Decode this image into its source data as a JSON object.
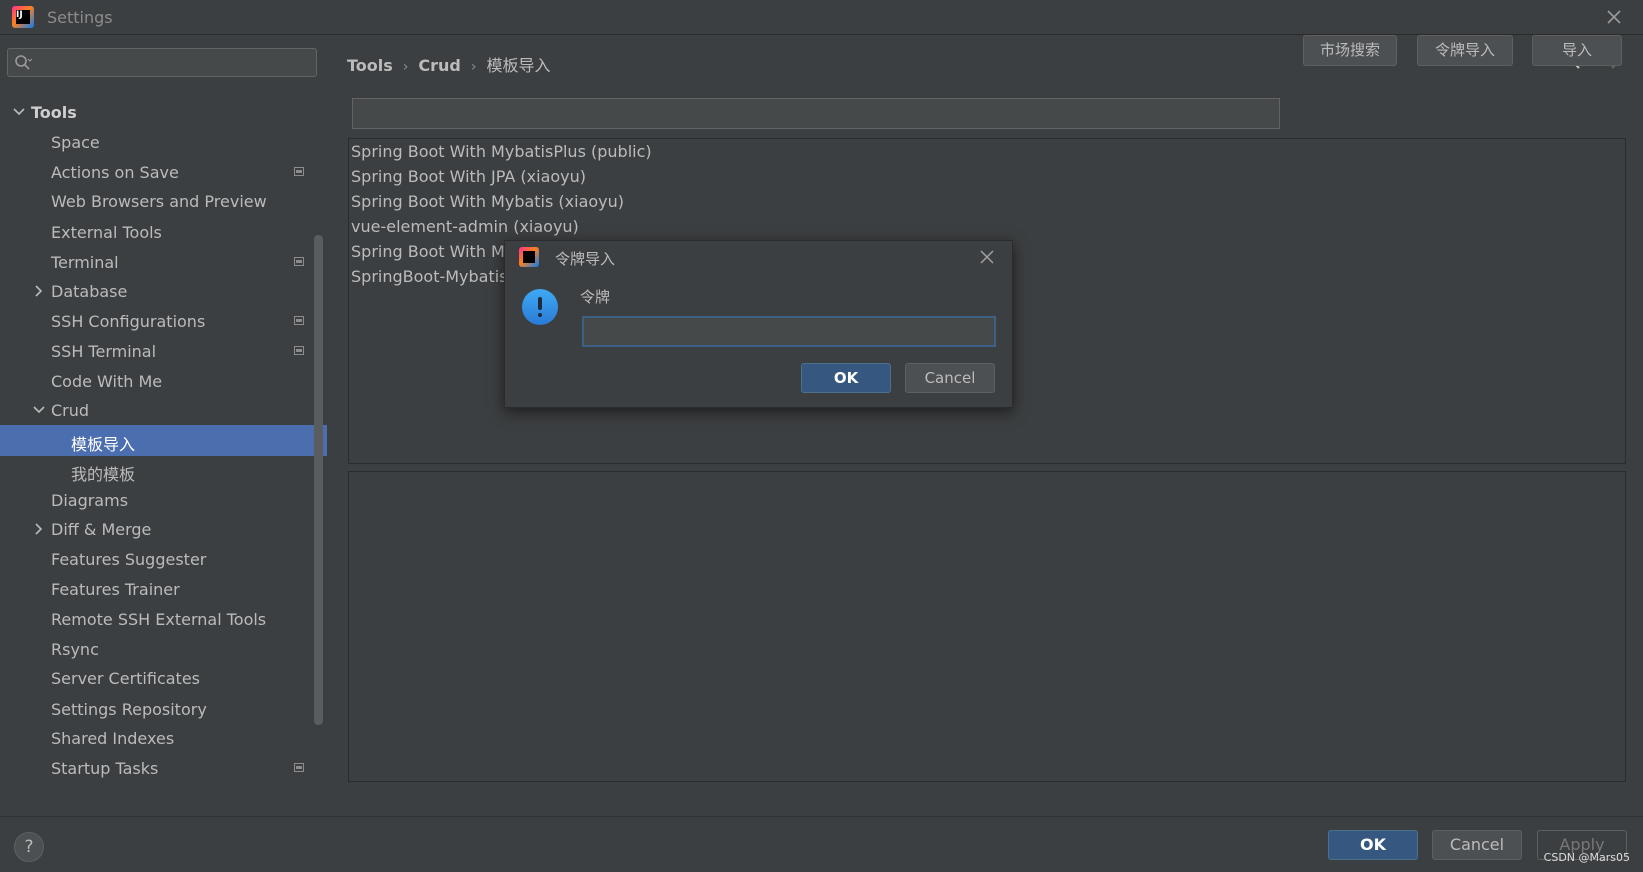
{
  "window": {
    "title": "Settings"
  },
  "sidebar": {
    "search": {
      "value": "",
      "placeholder": ""
    },
    "items": [
      {
        "label": "Tools",
        "expanded": true
      },
      {
        "label": "Space"
      },
      {
        "label": "Actions on Save"
      },
      {
        "label": "Web Browsers and Preview"
      },
      {
        "label": "External Tools"
      },
      {
        "label": "Terminal"
      },
      {
        "label": "Database",
        "expanded": false
      },
      {
        "label": "SSH Configurations"
      },
      {
        "label": "SSH Terminal"
      },
      {
        "label": "Code With Me"
      },
      {
        "label": "Crud",
        "expanded": true
      },
      {
        "label": "模板导入",
        "selected": true
      },
      {
        "label": "我的模板"
      },
      {
        "label": "Diagrams"
      },
      {
        "label": "Diff & Merge",
        "expanded": false
      },
      {
        "label": "Features Suggester"
      },
      {
        "label": "Features Trainer"
      },
      {
        "label": "Remote SSH External Tools"
      },
      {
        "label": "Rsync"
      },
      {
        "label": "Server Certificates"
      },
      {
        "label": "Settings Repository"
      },
      {
        "label": "Shared Indexes"
      },
      {
        "label": "Startup Tasks"
      }
    ]
  },
  "main": {
    "breadcrumb": [
      "Tools",
      "Crud",
      "模板导入"
    ],
    "url_input": {
      "value": ""
    },
    "buttons": {
      "market_search": "市场搜索",
      "token_import": "令牌导入",
      "import": "导入"
    },
    "templates": [
      "Spring Boot With MybatisPlus  (public)",
      "Spring Boot With JPA  (xiaoyu)",
      "Spring Boot With Mybatis  (xiaoyu)",
      "vue-element-admin  (xiaoyu)",
      "Spring Boot With My",
      "SpringBoot-Mybatis"
    ]
  },
  "dialog": {
    "title": "令牌导入",
    "field_label": "令牌",
    "token_value": "",
    "ok": "OK",
    "cancel": "Cancel"
  },
  "footer": {
    "help": "?",
    "ok": "OK",
    "cancel": "Cancel",
    "apply": "Apply",
    "watermark": "CSDN @Mars05"
  },
  "colors": {
    "background": "#3c3f41",
    "selection": "#4b6eaf",
    "primary_button": "#365880",
    "text": "#bbbbbb"
  }
}
